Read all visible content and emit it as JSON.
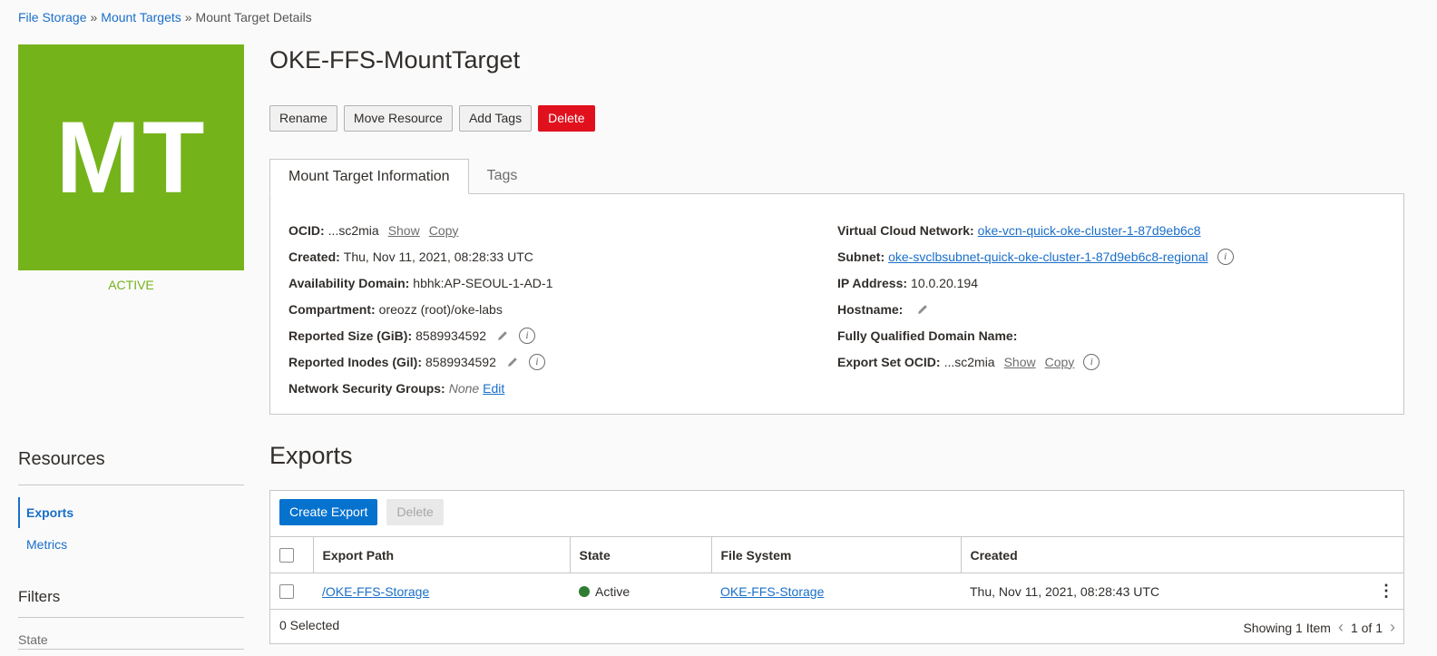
{
  "breadcrumb": {
    "root": "File Storage",
    "parent": "Mount Targets",
    "current": "Mount Target Details",
    "sep": "»"
  },
  "badge": {
    "initials": "MT",
    "state": "ACTIVE",
    "color": "#75b31b"
  },
  "title": "OKE-FFS-MountTarget",
  "actions": {
    "rename": "Rename",
    "move": "Move Resource",
    "add_tags": "Add Tags",
    "delete": "Delete"
  },
  "tabs": {
    "info": "Mount Target Information",
    "tags": "Tags"
  },
  "info_left": {
    "ocid_label": "OCID:",
    "ocid_value": "...sc2mia",
    "ocid_show": "Show",
    "ocid_copy": "Copy",
    "created_label": "Created:",
    "created_value": "Thu, Nov 11, 2021, 08:28:33 UTC",
    "ad_label": "Availability Domain:",
    "ad_value": "hbhk:AP-SEOUL-1-AD-1",
    "compartment_label": "Compartment:",
    "compartment_value": "oreozz (root)/oke-labs",
    "size_label": "Reported Size (GiB):",
    "size_value": "8589934592",
    "inodes_label": "Reported Inodes (Gil):",
    "inodes_value": "8589934592",
    "nsg_label": "Network Security Groups:",
    "nsg_value": "None",
    "nsg_edit": "Edit"
  },
  "info_right": {
    "vcn_label": "Virtual Cloud Network:",
    "vcn_value": "oke-vcn-quick-oke-cluster-1-87d9eb6c8",
    "subnet_label": "Subnet:",
    "subnet_value": "oke-svclbsubnet-quick-oke-cluster-1-87d9eb6c8-regional",
    "ip_label": "IP Address:",
    "ip_value": "10.0.20.194",
    "hostname_label": "Hostname:",
    "fqdn_label": "Fully Qualified Domain Name:",
    "exportset_label": "Export Set OCID:",
    "exportset_value": "...sc2mia",
    "exportset_show": "Show",
    "exportset_copy": "Copy"
  },
  "resources": {
    "title": "Resources",
    "exports": "Exports",
    "metrics": "Metrics"
  },
  "filters": {
    "title": "Filters",
    "state": "State"
  },
  "exports": {
    "title": "Exports",
    "create": "Create Export",
    "delete": "Delete",
    "columns": [
      "Export Path",
      "State",
      "File System",
      "Created"
    ],
    "rows": [
      {
        "path": "/OKE-FFS-Storage",
        "state": "Active",
        "fs": "OKE-FFS-Storage",
        "created": "Thu, Nov 11, 2021, 08:28:43 UTC"
      }
    ],
    "selected": "0 Selected",
    "showing": "Showing 1 Item",
    "page": "1 of 1"
  }
}
